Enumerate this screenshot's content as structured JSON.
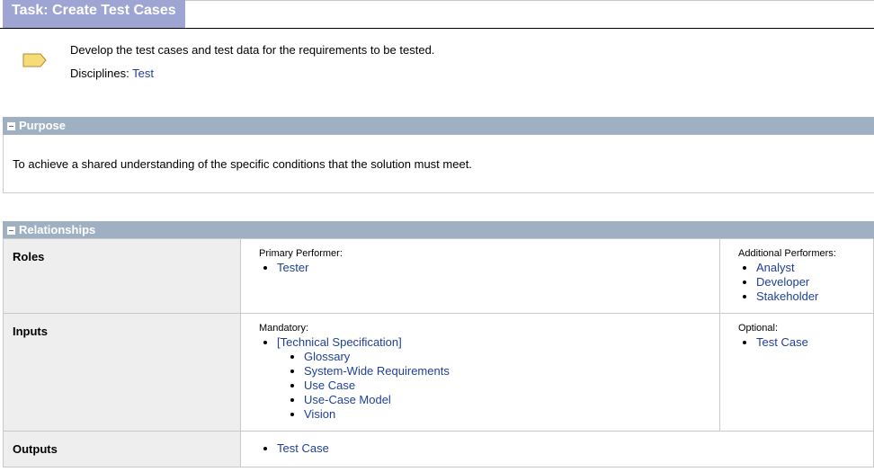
{
  "header": {
    "title": "Task: Create Test Cases"
  },
  "overview": {
    "brief": "Develop the test cases and test data for the requirements to be tested.",
    "disciplines_label": "Disciplines:",
    "disciplines_value": "Test"
  },
  "purpose": {
    "heading": "Purpose",
    "text": "To achieve a shared understanding of the specific conditions that the solution must meet."
  },
  "relationships": {
    "heading": "Relationships",
    "roles": {
      "label": "Roles",
      "primary_caption": "Primary Performer:",
      "primary": [
        "Tester"
      ],
      "additional_caption": "Additional Performers:",
      "additional": [
        "Analyst",
        "Developer",
        "Stakeholder"
      ]
    },
    "inputs": {
      "label": "Inputs",
      "mandatory_caption": "Mandatory:",
      "mandatory_group": "[Technical Specification]",
      "mandatory_items": [
        "Glossary",
        "System-Wide Requirements",
        "Use Case",
        "Use-Case Model",
        "Vision"
      ],
      "optional_caption": "Optional:",
      "optional": [
        "Test Case"
      ]
    },
    "outputs": {
      "label": "Outputs",
      "items": [
        "Test Case"
      ]
    }
  },
  "colors": {
    "title_tab": "#9fa5d3",
    "section_header": "#9fb0c2",
    "link": "#1f3f94",
    "label_cell": "#eeeeee",
    "task_icon": "#f6dc79"
  }
}
